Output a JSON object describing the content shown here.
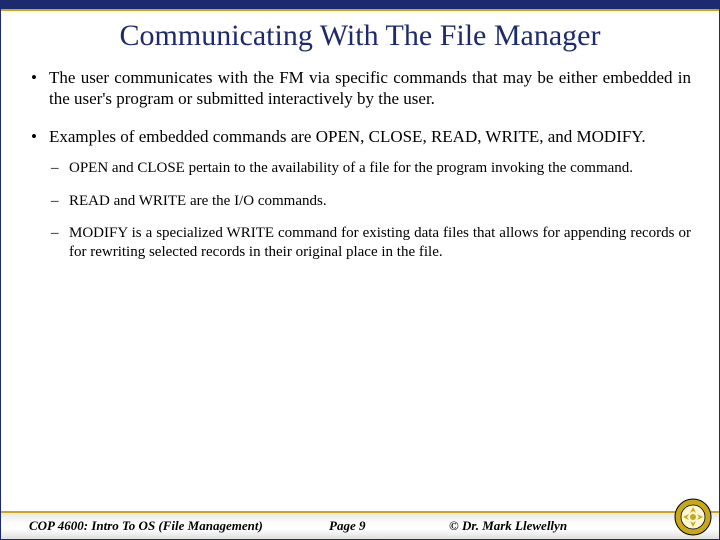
{
  "title": "Communicating With The File Manager",
  "bullets": {
    "b1": "The user communicates with the FM via specific commands that may be either embedded in the user's program or submitted interactively by the user.",
    "b2": "Examples of embedded commands are OPEN, CLOSE, READ, WRITE, and MODIFY.",
    "sub": {
      "s1": "OPEN and CLOSE pertain to the availability of a file for the program invoking the command.",
      "s2": "READ and WRITE are the I/O commands.",
      "s3": "MODIFY is a specialized WRITE command for existing data files that allows for appending records or for rewriting selected records in their original place in the file."
    }
  },
  "footer": {
    "course": "COP 4600: Intro To OS  (File Management)",
    "page": "Page 9",
    "author": "© Dr. Mark Llewellyn"
  }
}
